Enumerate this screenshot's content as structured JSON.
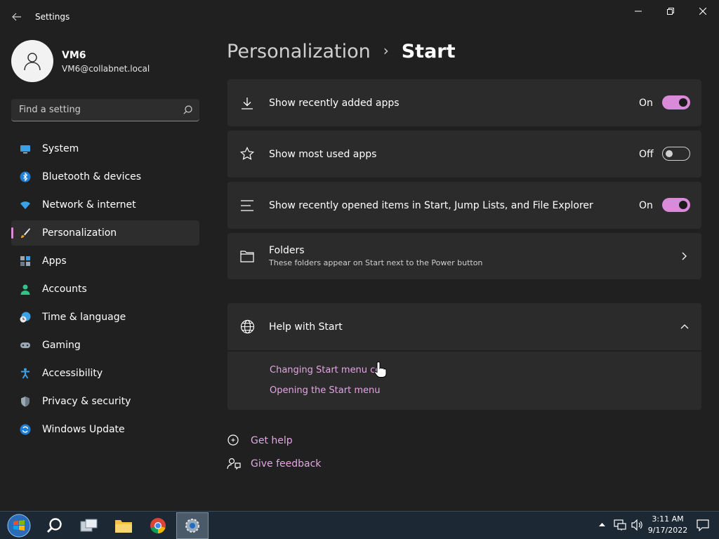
{
  "window": {
    "title": "Settings",
    "controls": [
      "minimize",
      "maximize",
      "close"
    ]
  },
  "profile": {
    "name": "VM6",
    "email": "VM6@collabnet.local"
  },
  "search": {
    "placeholder": "Find a setting"
  },
  "sidebar": {
    "items": [
      {
        "label": "System",
        "icon": "monitor-icon",
        "active": false
      },
      {
        "label": "Bluetooth & devices",
        "icon": "bluetooth-icon",
        "active": false
      },
      {
        "label": "Network & internet",
        "icon": "wifi-icon",
        "active": false
      },
      {
        "label": "Personalization",
        "icon": "brush-icon",
        "active": true
      },
      {
        "label": "Apps",
        "icon": "apps-icon",
        "active": false
      },
      {
        "label": "Accounts",
        "icon": "person-icon",
        "active": false
      },
      {
        "label": "Time & language",
        "icon": "globe-clock-icon",
        "active": false
      },
      {
        "label": "Gaming",
        "icon": "gamepad-icon",
        "active": false
      },
      {
        "label": "Accessibility",
        "icon": "accessibility-icon",
        "active": false
      },
      {
        "label": "Privacy & security",
        "icon": "shield-icon",
        "active": false
      },
      {
        "label": "Windows Update",
        "icon": "update-icon",
        "active": false
      }
    ]
  },
  "breadcrumb": {
    "parent": "Personalization",
    "separator": "›",
    "current": "Start"
  },
  "settings": {
    "recently_added": {
      "label": "Show recently added apps",
      "state": "On"
    },
    "most_used": {
      "label": "Show most used apps",
      "state": "Off"
    },
    "recently_opened": {
      "label": "Show recently opened items in Start, Jump Lists, and File Explorer",
      "state": "On"
    },
    "folders": {
      "label": "Folders",
      "description": "These folders appear on Start next to the Power button"
    }
  },
  "help": {
    "title": "Help with Start",
    "links": [
      "Changing Start menu co",
      "Opening the Start menu"
    ]
  },
  "footer": {
    "get_help": "Get help",
    "give_feedback": "Give feedback"
  },
  "taskbar": {
    "time": "3:11 AM",
    "date": "9/17/2022"
  },
  "colors": {
    "accent": "#d98ad9",
    "link": "#e3a6e3",
    "background": "#202020",
    "card": "#2b2b2b"
  }
}
